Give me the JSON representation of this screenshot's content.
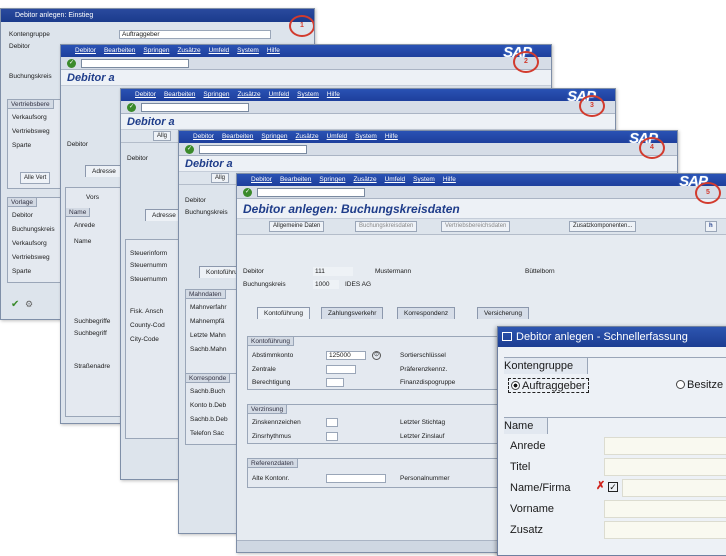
{
  "w1": {
    "title": "Debitor anlegen: Einstieg",
    "rows": [
      "Kontengruppe",
      "Debitor",
      "Buchungskreis"
    ],
    "kontengruppe_val": "Auftraggeber",
    "vertr_hdr": "Vertriebsbere",
    "vertr": [
      "Verkaufsorg",
      "Vertriebsweg",
      "Sparte"
    ],
    "vorlage_hdr": "Vorlage",
    "vorlage": [
      "Debitor",
      "Buchungskreis",
      "Verkaufsorg",
      "Vertriebsweg",
      "Sparte"
    ],
    "alle_btn": "Alle Vert",
    "mark": "1"
  },
  "menu": [
    "Debitor",
    "Bearbeiten",
    "Springen",
    "Zusätze",
    "Umfeld",
    "System",
    "Hilfe"
  ],
  "sap": "SAP",
  "w2": {
    "title": "Debitor a",
    "debitor": "Debitor",
    "adresse": "Adresse",
    "vors": "Vors",
    "name_hdr": "Name",
    "name": [
      "Anrede",
      "Name"
    ],
    "such_hdr": "Suchbegriffe",
    "such": "Suchbegriff",
    "strasse": "Straßenadre",
    "mark": "2"
  },
  "w3": {
    "title": "Debitor a",
    "btn": "Allg",
    "debitor": "Debitor",
    "adresse": "Adresse",
    "steuer": [
      "Steuerinform",
      "Steuernumm",
      "Steuernumm"
    ],
    "fisk": [
      "Fisk. Ansch",
      "County-Cod",
      "City-Code"
    ],
    "mark": "3"
  },
  "w4": {
    "title": "Debitor a",
    "btn": "Allg",
    "debitor": "Debitor",
    "bukrs": "Buchungskreis",
    "tab": "Kontoführung",
    "mahn_hdr": "Mahndaten",
    "mahn": [
      "Mahnverfahr",
      "Mahnempfä",
      "Letzte Mahn",
      "Sachb.Mahn"
    ],
    "korr_hdr": "Korresponde",
    "korr": [
      "Sachb.Buch",
      "Konto b.Deb",
      "Sachb.b.Deb",
      "Telefon Sac"
    ],
    "mark": "4"
  },
  "w5": {
    "title": "Debitor anlegen: Buchungskreisdaten",
    "buttons": [
      "Allgemeine Daten",
      "Buchungskreisdaten",
      "Vertriebsbereichsdaten",
      "Zusatzkomponenten..."
    ],
    "debitor_lbl": "Debitor",
    "debitor_val": "111",
    "name": "Mustermann",
    "city": "Büttelborn",
    "bukrs_lbl": "Buchungskreis",
    "bukrs_val": "1000",
    "bukrs_name": "IDES AG",
    "tabs": [
      "Kontoführung",
      "Zahlungsverkehr",
      "Korrespondenz",
      "Versicherung"
    ],
    "kf_hdr": "Kontoführung",
    "kf_left": [
      "Abstimmkonto",
      "Zentrale",
      "Berechtigung"
    ],
    "abstimm_val": "125000",
    "kf_right": [
      "Sortierschlüssel",
      "Präferenzkennz.",
      "Finanzdispogruppe"
    ],
    "verz_hdr": "Verzinsung",
    "verz_left": [
      "Zinskennzeichen",
      "Zinsrhythmus"
    ],
    "verz_right": [
      "Letzter Stichtag",
      "Letzter Zinslauf"
    ],
    "ref_hdr": "Referenzdaten",
    "ref_left": "Alte Kontonr.",
    "ref_right": "Personalnummer",
    "h_btn": "h",
    "mark": "5"
  },
  "dlg": {
    "title": "Debitor anlegen - Schnellerfassung",
    "grp": "Kontengruppe",
    "opt1": "Auftraggeber",
    "opt2": "Besitze",
    "name_hdr": "Name",
    "rows": [
      "Anrede",
      "Titel",
      "Name/Firma",
      "Vorname",
      "Zusatz"
    ]
  }
}
